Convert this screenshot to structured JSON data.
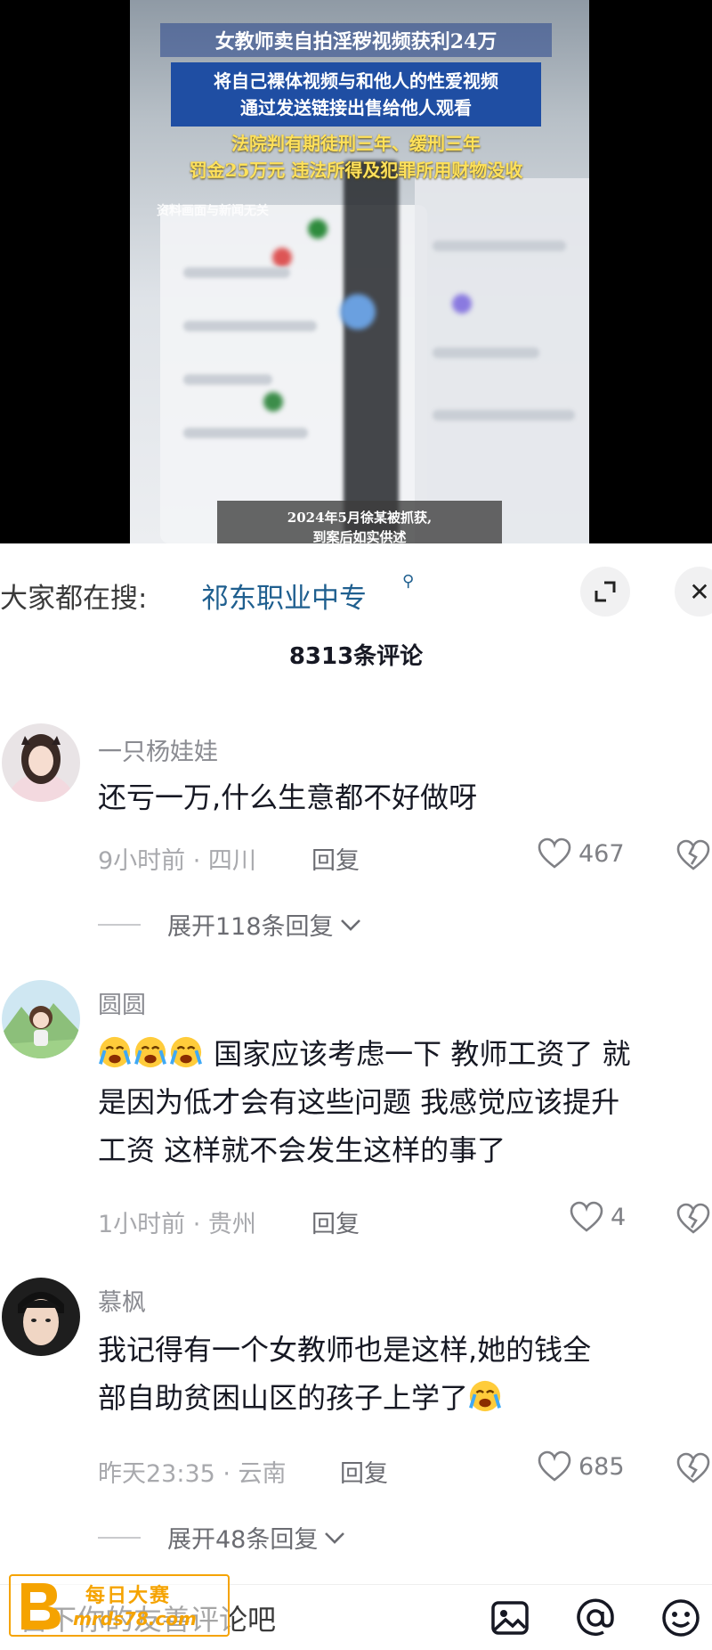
{
  "video": {
    "title": "女教师卖自拍淫秽视频获利24万",
    "box_line1": "将自己裸体视频与和他人的性爱视频",
    "box_line2": "通过发送链接出售给他人观看",
    "verdict_line1": "法院判有期徒刑三年、缓刑三年",
    "verdict_line2": "罚金25万元 违法所得及犯罪所用财物没收",
    "note": "资料画面与新闻无关",
    "subtitle_line1": "2024年5月徐某被抓获,",
    "subtitle_line2": "到案后如实供述"
  },
  "search": {
    "prefix": "大家都在搜:",
    "term": "祁东职业中专"
  },
  "comments_header": {
    "count_label": "8313条评论"
  },
  "comments": [
    {
      "username": "一只杨娃娃",
      "text": "还亏一万,什么生意都不好做呀",
      "time_location": "9小时前 · 四川",
      "reply_label": "回复",
      "likes": "467",
      "expand_label": "展开118条回复"
    },
    {
      "username": "圆圆",
      "text_line1": "国家应该考虑一下 教师工资了 就",
      "text_line2": "是因为低才会有这些问题 我感觉应该提升",
      "text_line3": "工资 这样就不会发生这样的事了",
      "time_location": "1小时前 · 贵州",
      "reply_label": "回复",
      "likes": "4"
    },
    {
      "username": "慕枫",
      "text_line1": "我记得有一个女教师也是这样,她的钱全",
      "text_line2": "部自助贫困山区的孩子上学了",
      "time_location": "昨天23:35 · 云南",
      "reply_label": "回复",
      "likes": "685",
      "expand_label": "展开48条回复"
    }
  ],
  "input_bar": {
    "placeholder": "留下你的友善评论吧",
    "icons": [
      "image-icon",
      "at-icon",
      "emoji-icon"
    ]
  },
  "watermark": {
    "line1": "每日大赛",
    "line2": "mrds78.com"
  },
  "colors": {
    "search_term": "#1f5f8f",
    "caption_box": "#1f4ea3",
    "caption_verdict": "#ffe15a",
    "watermark": "#f5a300"
  }
}
